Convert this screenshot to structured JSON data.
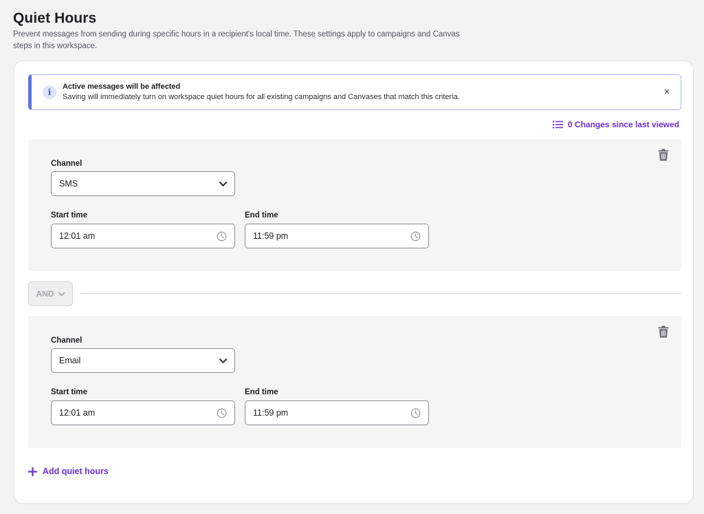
{
  "header": {
    "title": "Quiet Hours",
    "description": "Prevent messages from sending during specific hours in a recipient's local time. These settings apply to campaigns and Canvas steps in this workspace."
  },
  "alert": {
    "icon": "info-icon",
    "icon_glyph": "i",
    "title": "Active messages will be affected",
    "body": "Saving will immediately turn on workspace quiet hours for all existing campaigns and Canvases that match this criteria.",
    "close_glyph": "×"
  },
  "changes_link": {
    "label": "0 Changes since last viewed",
    "icon": "list-icon"
  },
  "rules": [
    {
      "channel_label": "Channel",
      "channel_value": "SMS",
      "start_label": "Start time",
      "start_value": "12:01 am",
      "end_label": "End time",
      "end_value": "11:59 pm"
    },
    {
      "channel_label": "Channel",
      "channel_value": "Email",
      "start_label": "Start time",
      "start_value": "12:01 am",
      "end_label": "End time",
      "end_value": "11:59 pm"
    }
  ],
  "combinator": {
    "label": "AND"
  },
  "add_link": {
    "label": "Add quiet hours",
    "icon": "plus-icon"
  },
  "colors": {
    "accent": "#6b2fd0",
    "info_border": "#5b74e6",
    "page_bg": "#f3f3f4",
    "rule_bg": "#f5f5f6"
  }
}
